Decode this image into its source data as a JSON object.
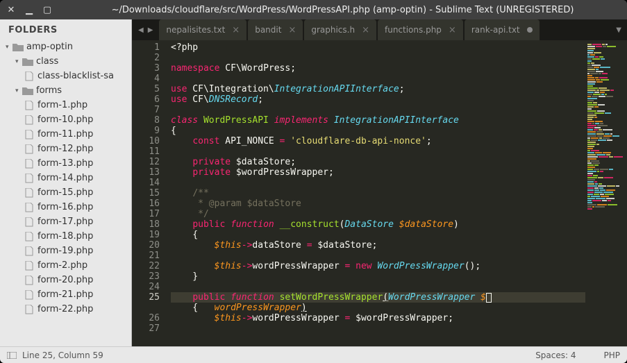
{
  "titlebar": {
    "title": "~/Downloads/cloudflare/src/WordPress/WordPressAPI.php (amp-optin) - Sublime Text (UNREGISTERED)"
  },
  "sidebar": {
    "header": "FOLDERS",
    "root": "amp-optin",
    "folders": [
      {
        "name": "class",
        "expanded": true,
        "children": [
          {
            "name": "class-blacklist-sa",
            "type": "file"
          }
        ]
      },
      {
        "name": "forms",
        "expanded": true,
        "children": [
          {
            "name": "form-1.php",
            "type": "file"
          },
          {
            "name": "form-10.php",
            "type": "file"
          },
          {
            "name": "form-11.php",
            "type": "file"
          },
          {
            "name": "form-12.php",
            "type": "file"
          },
          {
            "name": "form-13.php",
            "type": "file"
          },
          {
            "name": "form-14.php",
            "type": "file"
          },
          {
            "name": "form-15.php",
            "type": "file"
          },
          {
            "name": "form-16.php",
            "type": "file"
          },
          {
            "name": "form-17.php",
            "type": "file"
          },
          {
            "name": "form-18.php",
            "type": "file"
          },
          {
            "name": "form-19.php",
            "type": "file"
          },
          {
            "name": "form-2.php",
            "type": "file"
          },
          {
            "name": "form-20.php",
            "type": "file"
          },
          {
            "name": "form-21.php",
            "type": "file"
          },
          {
            "name": "form-22.php",
            "type": "file"
          }
        ]
      }
    ]
  },
  "tabs": [
    {
      "label": "nepalisites.txt",
      "dirty": false
    },
    {
      "label": "bandit",
      "dirty": false
    },
    {
      "label": "graphics.h",
      "dirty": false
    },
    {
      "label": "functions.php",
      "dirty": false
    },
    {
      "label": "rank-api.txt",
      "dirty": true
    }
  ],
  "code": {
    "active_line": 25,
    "lines_start": 1,
    "lines_end": 27
  },
  "statusbar": {
    "position": "Line 25, Column 59",
    "spaces": "Spaces: 4",
    "language": "PHP"
  }
}
